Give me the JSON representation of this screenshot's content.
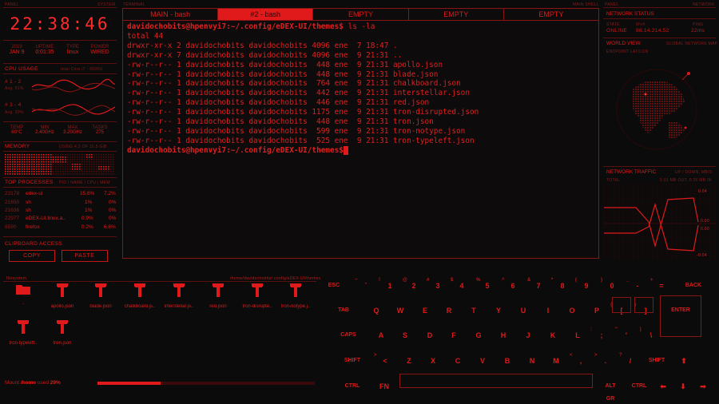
{
  "top_labels": {
    "left_panel": "PANEL",
    "left_system": "SYSTEM",
    "terminal": "TERMINAL",
    "main_shell": "MAIN SHELL",
    "right_panel": "PANEL",
    "right_network": "NETWORK"
  },
  "clock": {
    "time": "22:38:46"
  },
  "system": {
    "cols": [
      {
        "title": "2019",
        "value": "JAN 9"
      },
      {
        "title": "UPTIME",
        "value": "0:01:35"
      },
      {
        "title": "TYPE",
        "value": "linux"
      },
      {
        "title": "POWER",
        "value": "WIRED"
      }
    ]
  },
  "cpu": {
    "title": "CPU USAGE",
    "model": "Intel Core i7 - 6500U",
    "cores_a": "# 1 - 2",
    "avg_a": "Avg. 51%",
    "cores_b": "# 3 - 4",
    "avg_b": "Avg. 39%",
    "stats": [
      {
        "title": "TEMP",
        "value": "60°C"
      },
      {
        "title": "MIN",
        "value": "2.40GHz"
      },
      {
        "title": "MAX",
        "value": "3.20GHz"
      },
      {
        "title": "TASKS",
        "value": "275"
      }
    ]
  },
  "memory": {
    "title": "MEMORY",
    "usage": "USING 4.3 OF 15.5 GiB"
  },
  "processes": {
    "title": "TOP PROCESSES",
    "header": "PID | NAME | CPU | MEM",
    "rows": [
      {
        "pid": "23178",
        "name": "edex-ui",
        "cpu": "15.6%",
        "mem": "7.2%"
      },
      {
        "pid": "21650",
        "name": "sh",
        "cpu": "1%",
        "mem": "0%"
      },
      {
        "pid": "21636",
        "name": "sh",
        "cpu": "1%",
        "mem": "0%"
      },
      {
        "pid": "22977",
        "name": "eDEX-UI.linux.a..",
        "cpu": "0.9%",
        "mem": "0%"
      },
      {
        "pid": "6590",
        "name": "firefox",
        "cpu": "0.2%",
        "mem": "6.6%"
      }
    ]
  },
  "clipboard": {
    "title": "CLIPBOARD ACCESS",
    "copy": "COPY",
    "paste": "PASTE"
  },
  "terminal": {
    "tabs": [
      "MAIN - bash",
      "#2 - bash",
      "EMPTY",
      "EMPTY",
      "EMPTY"
    ],
    "prompt": "davidochobits@hpenvyi7",
    "path": ":~/.config/eDEX-UI/themes$",
    "command": " ls -la",
    "total": "total 44",
    "lines": [
      "drwxr-xr-x 2 davidochobits davidochobits 4096 ene  7 18:47 .",
      "drwxr-xr-x 7 davidochobits davidochobits 4096 ene  9 21:31 ..",
      "-rw-r--r-- 1 davidochobits davidochobits  448 ene  9 21:31 apollo.json",
      "-rw-r--r-- 1 davidochobits davidochobits  448 ene  9 21:31 blade.json",
      "-rw-r--r-- 1 davidochobits davidochobits  764 ene  9 21:31 chalkboard.json",
      "-rw-r--r-- 1 davidochobits davidochobits  442 ene  9 21:31 interstellar.json",
      "-rw-r--r-- 1 davidochobits davidochobits  446 ene  9 21:31 red.json",
      "-rw-r--r-- 1 davidochobits davidochobits 1175 ene  9 21:31 tron-disrupted.json",
      "-rw-r--r-- 1 davidochobits davidochobits  448 ene  9 21:31 tron.json",
      "-rw-r--r-- 1 davidochobits davidochobits  599 ene  9 21:31 tron-notype.json",
      "-rw-r--r-- 1 davidochobits davidochobits  525 ene  9 21:31 tron-typeleft.json"
    ]
  },
  "network": {
    "title": "NETWORK STATUS",
    "state_label": "STATE",
    "state": "ONLINE",
    "ip_label": "IPv4",
    "ip": "88.14.214.52",
    "ping_label": "PING",
    "ping": "22ms",
    "world_title": "WORLD VIEW",
    "world_sub": "GLOBAL NETWORK MAP",
    "endpoint": "ENDPOINT LAT/LON",
    "traffic_title": "NETWORK TRAFFIC",
    "traffic_sub": "UP / DOWN, MB/S",
    "total_label": "TOTAL",
    "total_value": "0.01 MB OUT, 0.35 MB IN",
    "chart_labels": [
      "0.04",
      "0.00",
      "0.00",
      "-0.04"
    ]
  },
  "filesystem": {
    "title": "filesystem",
    "path": "/home/davidochobits/.config/eDEX-UI/themes",
    "files": [
      "..",
      "apollo.json",
      "blade.json",
      "chalkboard.js..",
      "interstellar.js..",
      "red.json",
      "tron-disrupte..",
      "tron-notype.j..",
      "tron-typeleft..",
      "tron.json"
    ],
    "mount_label": "Mount",
    "mount_path": "/home",
    "mount_used": "used",
    "mount_pct": "29%",
    "mount_fraction": 0.29
  },
  "keyboard": {
    "row1": [
      {
        "main": "ESC"
      },
      {
        "main": "`",
        "sub": "~"
      },
      {
        "main": "1",
        "sub": "!"
      },
      {
        "main": "2",
        "sub": "@"
      },
      {
        "main": "3",
        "sub": "#"
      },
      {
        "main": "4",
        "sub": "$"
      },
      {
        "main": "5",
        "sub": "%"
      },
      {
        "main": "6",
        "sub": "^"
      },
      {
        "main": "7",
        "sub": "&"
      },
      {
        "main": "8",
        "sub": "*"
      },
      {
        "main": "9",
        "sub": "("
      },
      {
        "main": "0",
        "sub": ")"
      },
      {
        "main": "-",
        "sub": "_"
      },
      {
        "main": "=",
        "sub": "+"
      },
      {
        "main": "BACK"
      }
    ],
    "row2": [
      {
        "main": "TAB"
      },
      {
        "main": "Q"
      },
      {
        "main": "W"
      },
      {
        "main": "E"
      },
      {
        "main": "R"
      },
      {
        "main": "T"
      },
      {
        "main": "Y"
      },
      {
        "main": "U"
      },
      {
        "main": "I"
      },
      {
        "main": "O"
      },
      {
        "main": "P"
      },
      {
        "main": "[",
        "sub": "{"
      },
      {
        "main": "]",
        "sub": "}"
      },
      {
        "main": "ENTER"
      }
    ],
    "row3": [
      {
        "main": "CAPS"
      },
      {
        "main": "A"
      },
      {
        "main": "S"
      },
      {
        "main": "D"
      },
      {
        "main": "F"
      },
      {
        "main": "G"
      },
      {
        "main": "H"
      },
      {
        "main": "J"
      },
      {
        "main": "K"
      },
      {
        "main": "L"
      },
      {
        "main": ";",
        "sub": ":"
      },
      {
        "main": "'",
        "sub": "\""
      },
      {
        "main": "\\",
        "sub": "|"
      }
    ],
    "row4": [
      {
        "main": "SHIFT"
      },
      {
        "main": "<",
        "sub": ">"
      },
      {
        "main": "Z"
      },
      {
        "main": "X"
      },
      {
        "main": "C"
      },
      {
        "main": "V"
      },
      {
        "main": "B"
      },
      {
        "main": "N"
      },
      {
        "main": "M"
      },
      {
        "main": ",",
        "sub": "<"
      },
      {
        "main": ".",
        "sub": ">"
      },
      {
        "main": "/",
        "sub": "?"
      },
      {
        "main": "SHIFT"
      },
      {
        "main": "⬆"
      }
    ],
    "row5": [
      {
        "main": "CTRL"
      },
      {
        "main": "FN"
      },
      {
        "main": "ALT GR"
      },
      {
        "main": "CTRL"
      },
      {
        "main": "⬅"
      },
      {
        "main": "⬇"
      },
      {
        "main": "➡"
      }
    ]
  }
}
